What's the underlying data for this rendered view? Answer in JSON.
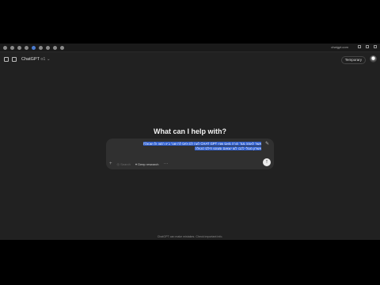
{
  "browser": {
    "url": "chatgpt.com"
  },
  "header": {
    "model_name": "ChatGPT",
    "model_version": "o1",
    "temporary_label": "Temporary"
  },
  "main": {
    "headline": "What can I help with?"
  },
  "composer": {
    "prompt_line1": "אשר לאמה מגד הורה מאס שניו CHAT GPT לעה לס ופוס לת שנר ביוו רמצו ולו שנעלת",
    "prompt_line2": "אשרון מגולי לכבו לעו יוצאום ומצוטו חילס כוטולה",
    "chip_search": "Search",
    "chip_reason": "Deep research",
    "send_icon": "arrow-up-icon"
  },
  "footer": {
    "disclaimer": "ChatGPT can make mistakes. Check important info."
  }
}
